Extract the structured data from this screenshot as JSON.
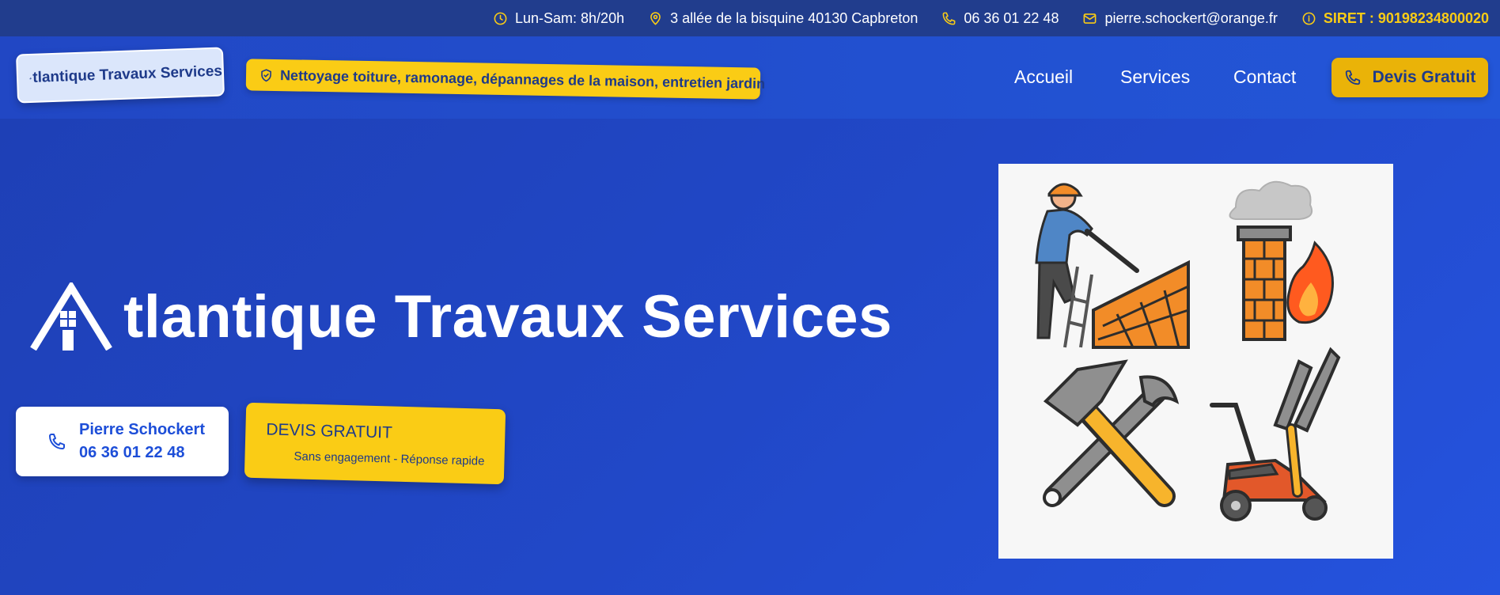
{
  "topbar": {
    "hours": "Lun-Sam: 8h/20h",
    "address": "3 allée de la bisquine 40130 Capbreton",
    "phone": "06 36 01 22 48",
    "email": "pierre.schockert@orange.fr",
    "siret": "SIRET : 90198234800020",
    "icons": [
      "clock-icon",
      "map-pin-icon",
      "phone-icon",
      "mail-icon",
      "info-icon"
    ]
  },
  "header": {
    "logo_text": "tlantique Travaux Services",
    "tagline": "Nettoyage toiture, ramonage, dépannages de la maison, entretien jardin",
    "nav": [
      "Accueil",
      "Services",
      "Contact"
    ],
    "cta_label": "Devis Gratuit"
  },
  "hero": {
    "title": "tlantique Travaux Services",
    "contact_name": "Pierre Schockert",
    "contact_phone": "06 36 01 22 48",
    "devis_title": "DEVIS GRATUIT",
    "devis_subtitle": "Sans engagement - Réponse rapide"
  },
  "colors": {
    "topbar_bg": "#213d8d",
    "hero_bg": "#1e40af",
    "accent_yellow": "#facc15",
    "text_blue": "#1e3a8a",
    "link_blue": "#1d4ed8"
  }
}
